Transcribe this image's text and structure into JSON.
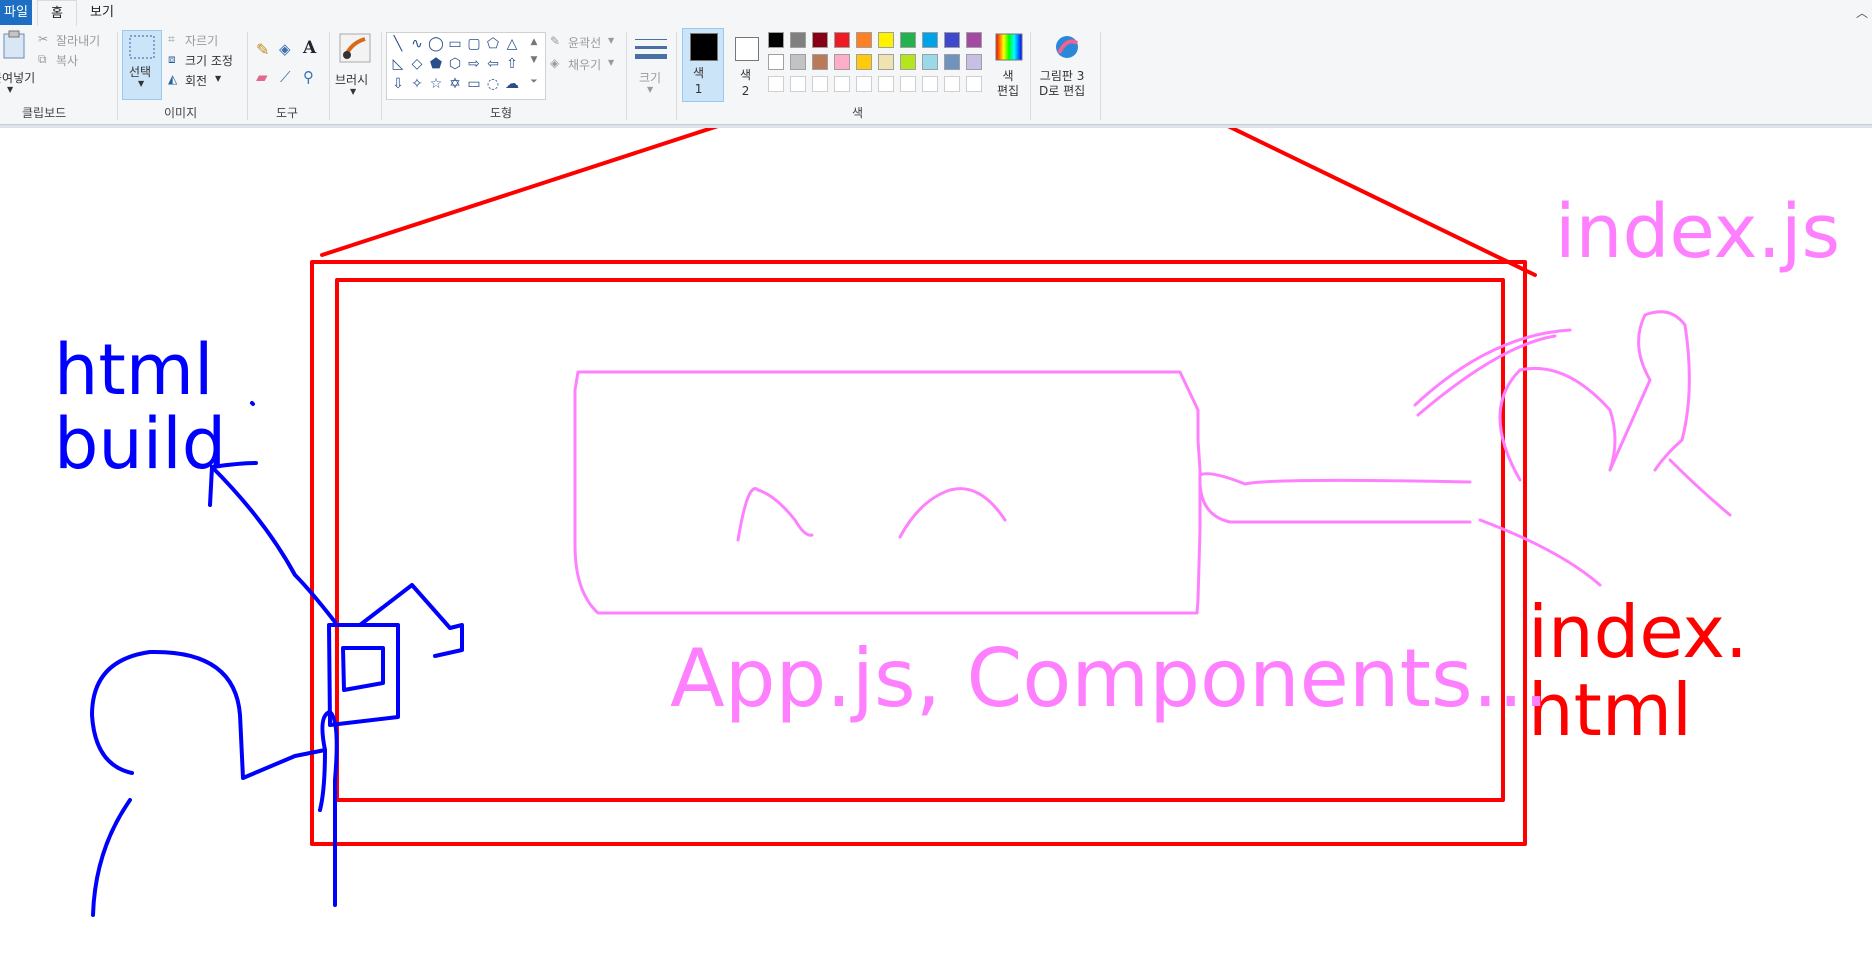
{
  "tabs": {
    "file": "파일",
    "home": "홈",
    "view": "보기"
  },
  "clipboard": {
    "paste": "붙여넣기",
    "cut": "잘라내기",
    "copy": "복사",
    "group": "클립보드"
  },
  "image": {
    "select": "선택",
    "crop": "자르기",
    "resize": "크기 조정",
    "rotate": "회전",
    "group": "이미지"
  },
  "tools": {
    "group": "도구"
  },
  "brushes": {
    "label": "브러시"
  },
  "shapes": {
    "outline": "윤곽선",
    "fill": "채우기",
    "group": "도형"
  },
  "size": {
    "label": "크기"
  },
  "colors": {
    "color1": "색\n1",
    "color2": "색\n2",
    "edit": "색\n편집",
    "paint3d": "그림판 3\nD로 편집",
    "group": "색",
    "palette": [
      "#000000",
      "#7f7f7f",
      "#880015",
      "#ed1c24",
      "#ff7f27",
      "#fff200",
      "#22b14c",
      "#00a2e8",
      "#3f48cc",
      "#a349a4",
      "#ffffff",
      "#c3c3c3",
      "#b97a57",
      "#ffaec9",
      "#ffc90e",
      "#efe4b0",
      "#b5e61d",
      "#99d9ea",
      "#7092be",
      "#c8bfe7"
    ],
    "primary": "#000000",
    "secondary": "#ffffff"
  },
  "canvas_labels": {
    "html_build": "html\nbuild",
    "index_js": "index.js",
    "index_html": "index.\nhtml",
    "app_components": "App.js, Components..."
  },
  "stroke_colors": {
    "red": "#ff0000",
    "pink": "#ff80ff",
    "blue": "#0000ff"
  }
}
